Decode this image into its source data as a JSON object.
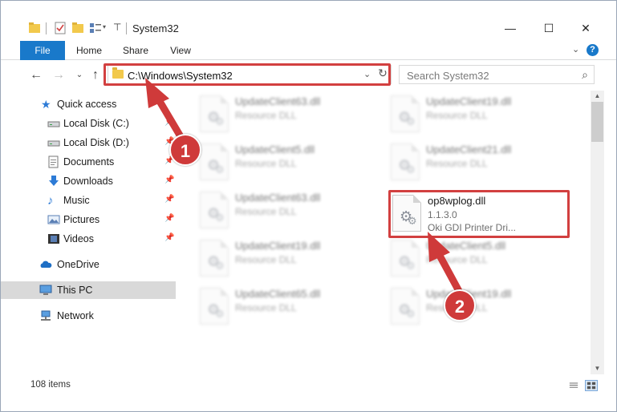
{
  "window": {
    "title": "System32",
    "controls": {
      "minimize": "—",
      "maximize": "☐",
      "close": "✕"
    }
  },
  "ribbon": {
    "tabs": [
      "File",
      "Home",
      "Share",
      "View"
    ],
    "expand_icon": "chevron-down-icon",
    "help": "?"
  },
  "nav": {
    "address": "C:\\Windows\\System32",
    "search_placeholder": "Search System32",
    "refresh": "↻",
    "dropdown": "⌄"
  },
  "sidebar": {
    "items": [
      {
        "label": "Quick access",
        "icon": "star-icon",
        "pinned": false
      },
      {
        "label": "Local Disk (C:)",
        "icon": "drive-icon",
        "pinned": true
      },
      {
        "label": "Local Disk (D:)",
        "icon": "drive-icon",
        "pinned": true
      },
      {
        "label": "Documents",
        "icon": "documents-icon",
        "pinned": true
      },
      {
        "label": "Downloads",
        "icon": "download-icon",
        "pinned": true
      },
      {
        "label": "Music",
        "icon": "music-icon",
        "pinned": true
      },
      {
        "label": "Pictures",
        "icon": "pictures-icon",
        "pinned": true
      },
      {
        "label": "Videos",
        "icon": "videos-icon",
        "pinned": true
      },
      {
        "label": "OneDrive",
        "icon": "cloud-icon",
        "pinned": false
      },
      {
        "label": "This PC",
        "icon": "pc-icon",
        "pinned": false,
        "selected": true
      },
      {
        "label": "Network",
        "icon": "network-icon",
        "pinned": false
      }
    ]
  },
  "files": [
    {
      "name": "UpdateClient63.dll",
      "type": "Resource DLL"
    },
    {
      "name": "UpdateClient19.dll",
      "type": "Resource DLL"
    },
    {
      "name": "UpdateClient5.dll",
      "type": "Resource DLL"
    },
    {
      "name": "UpdateClient21.dll",
      "type": "Resource DLL"
    },
    {
      "name": "UpdateClient63.dll",
      "type": "Resource DLL"
    },
    {
      "name": "op8wplog.dll",
      "version": "1.1.3.0",
      "description": "Oki GDI Printer Dri..."
    },
    {
      "name": "UpdateClient19.dll",
      "type": "Resource DLL"
    },
    {
      "name": "UpdateClient5.dll",
      "type": "Resource DLL"
    },
    {
      "name": "UpdateClient65.dll",
      "type": "Resource DLL"
    },
    {
      "name": "UpdateClient19.dll",
      "type": "Resource DLL"
    }
  ],
  "status": {
    "items": "108 items"
  },
  "annotations": {
    "step1": "1",
    "step2": "2",
    "color": "#cf3a3a"
  }
}
